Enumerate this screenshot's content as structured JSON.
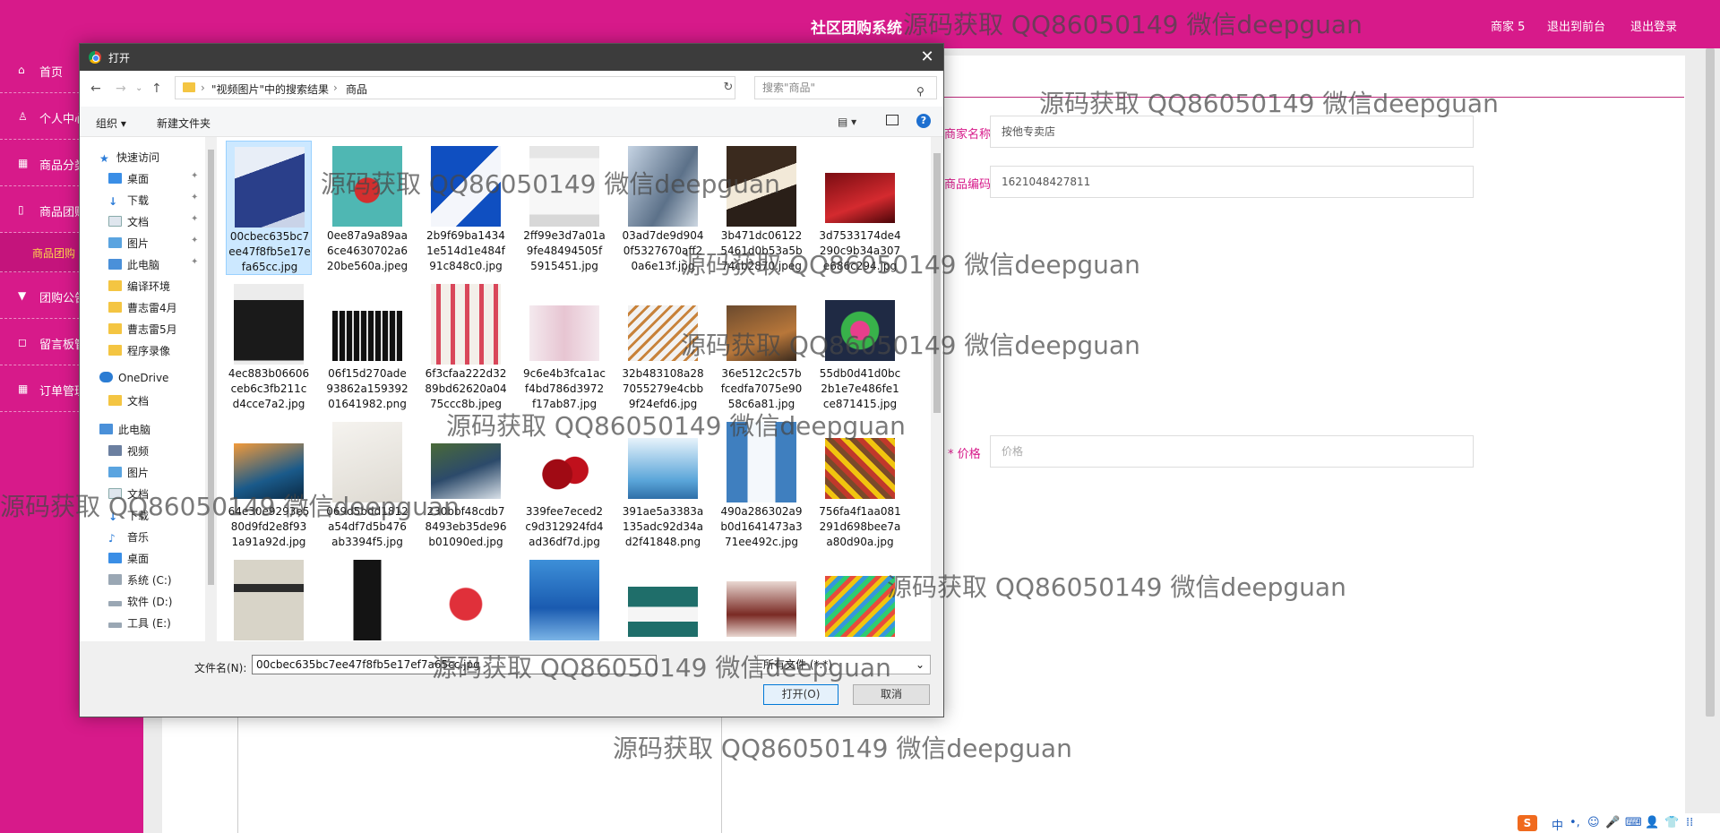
{
  "header": {
    "title": "社区团购系统",
    "links": [
      "商家 5",
      "退出到前台",
      "退出登录"
    ]
  },
  "sidebar": {
    "items": [
      "首页",
      "个人中心",
      "商品分类",
      "商品团购",
      "团购公告",
      "留言板管",
      "订单管理"
    ],
    "sub_item": "商品团购"
  },
  "form": {
    "shop_label": "商家名称",
    "shop_value": "按他专卖店",
    "code_label": "商品编码",
    "code_value": "1621048427811",
    "price_label": "* 价格",
    "price_placeholder": "价格"
  },
  "dialog": {
    "title": "打开",
    "breadcrumb": [
      "\"视频图片\"中的搜索结果",
      "商品"
    ],
    "search_placeholder": "搜索\"商品\"",
    "organize": "组织 ▾",
    "new_folder": "新建文件夹",
    "nav": {
      "quick_access": "快速访问",
      "quick_items": [
        "桌面",
        "下载",
        "文档",
        "图片",
        "此电脑",
        "编译环境",
        "曹志雷4月",
        "曹志雷5月",
        "程序录像"
      ],
      "onedrive": "OneDrive",
      "onedrive_items": [
        "文档"
      ],
      "this_pc": "此电脑",
      "pc_items": [
        "视频",
        "图片",
        "文档",
        "下载",
        "音乐",
        "桌面",
        "系统 (C:)",
        "软件 (D:)",
        "工具 (E:)"
      ]
    },
    "files": [
      "00cbec635bc7ee47f8fb5e17efa65cc.jpg",
      "0ee87a9a89aa6ce4630702a620be560a.jpeg",
      "2b9f69ba14341e514d1e484f91c848c0.jpg",
      "2ff99e3d7a01a9fe48494505f5915451.jpg",
      "03ad7de9d9040f5327670aff20a6e13f.jpg",
      "3b471dc061225461d0b53a5b74cb2870.jpeg",
      "3d7533174de4290c9b34a307e686c294.jpg",
      "4ec883b06606ceb6c3fb211cd4cce7a2.jpg",
      "06f15d270ade93862a15939201641982.png",
      "6f3cfaa222d3289bd62620a0475ccc8b.jpeg",
      "9c6e4b3fca1acf4bd786d3972f17ab87.jpg",
      "32b483108a287055279e4cbb9f24efd6.jpg",
      "36e512c2c57bfcedfa7075e9058c6a81.jpg",
      "55db0d41d0bc2b1e7e486fe1ce871415.jpg",
      "64e30e9293e580d9fd2e8f931a91a92d.jpg",
      "069d5bdd1812a54df7d5b476ab3394f5.jpg",
      "230bbf48cdb78493eb35de96b01090ed.jpg",
      "339fee7eced2c9d312924fd4ad36df7d.jpg",
      "391ae5a3383a135adc92d34ad2f41848.png",
      "490a286302a9b0d1641473a371ee492c.jpg",
      "756fa4f1aa081291d698bee7aa80d90a.jpg",
      "",
      "",
      "",
      "",
      "",
      "",
      ""
    ],
    "filename_label": "文件名(N):",
    "filename_value": "00cbec635bc7ee47f8fb5e17ef7a65cc.jpg",
    "filter_value": "所有文件 (*.*)",
    "open_label": "打开(O)",
    "cancel_label": "取消"
  },
  "watermark": "源码获取 QQ86050149 微信deepguan",
  "tray": [
    "中",
    "•,",
    "☺",
    "🎤",
    "⌨",
    "👤",
    "👕",
    "⁞⁞"
  ]
}
